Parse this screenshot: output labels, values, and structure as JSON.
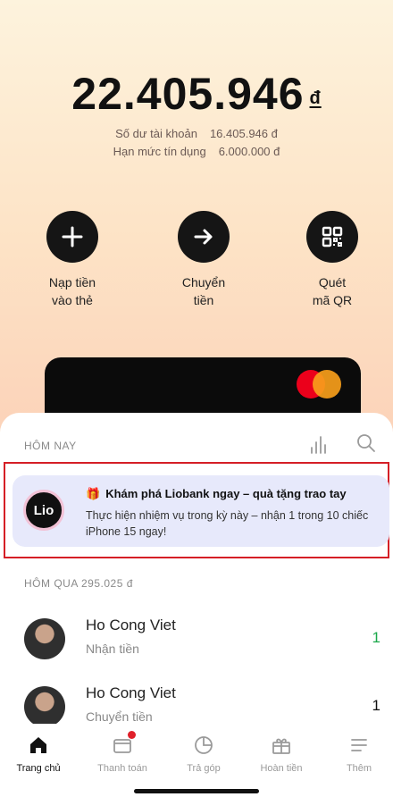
{
  "balance": {
    "amount": "22.405.946",
    "currency": "đ"
  },
  "account": {
    "balance_label": "Số dư tài khoản",
    "balance_value": "16.405.946 đ",
    "credit_label": "Hạn mức tín dụng",
    "credit_value": "6.000.000 đ"
  },
  "actions": [
    {
      "label_line1": "Nạp tiền",
      "label_line2": "vào thẻ",
      "icon": "plus-icon"
    },
    {
      "label_line1": "Chuyển",
      "label_line2": "tiền",
      "icon": "arrow-right-icon"
    },
    {
      "label_line1": "Quét",
      "label_line2": "mã QR",
      "icon": "qr-code-icon"
    }
  ],
  "card": {
    "brand": "mastercard-logo"
  },
  "today": {
    "label": "HÔM NAY"
  },
  "promo": {
    "logo_text": "Lio",
    "title": "Khám phá Liobank ngay – quà tặng trao tay",
    "body": "Thực hiện nhiệm vụ trong kỳ này – nhận 1 trong 10 chiếc iPhone 15 ngay!"
  },
  "yesterday": {
    "label": "HÔM QUA 295.025 đ"
  },
  "transactions": [
    {
      "name": "Ho Cong Viet",
      "type": "Nhận tiền",
      "amount": "1"
    },
    {
      "name": "Ho Cong Viet",
      "type": "Chuyển tiền",
      "amount": "1"
    }
  ],
  "tabs": [
    {
      "label": "Trang chủ",
      "icon": "home-icon"
    },
    {
      "label": "Thanh toán",
      "icon": "wallet-icon"
    },
    {
      "label": "Trả góp",
      "icon": "pie-chart-icon"
    },
    {
      "label": "Hoàn tiền",
      "icon": "gift-box-icon"
    },
    {
      "label": "Thêm",
      "icon": "menu-icon"
    }
  ],
  "colors": {
    "accent_red": "#d51f26",
    "income_green": "#1ba84a",
    "promo_bg": "#e7e9fb"
  }
}
